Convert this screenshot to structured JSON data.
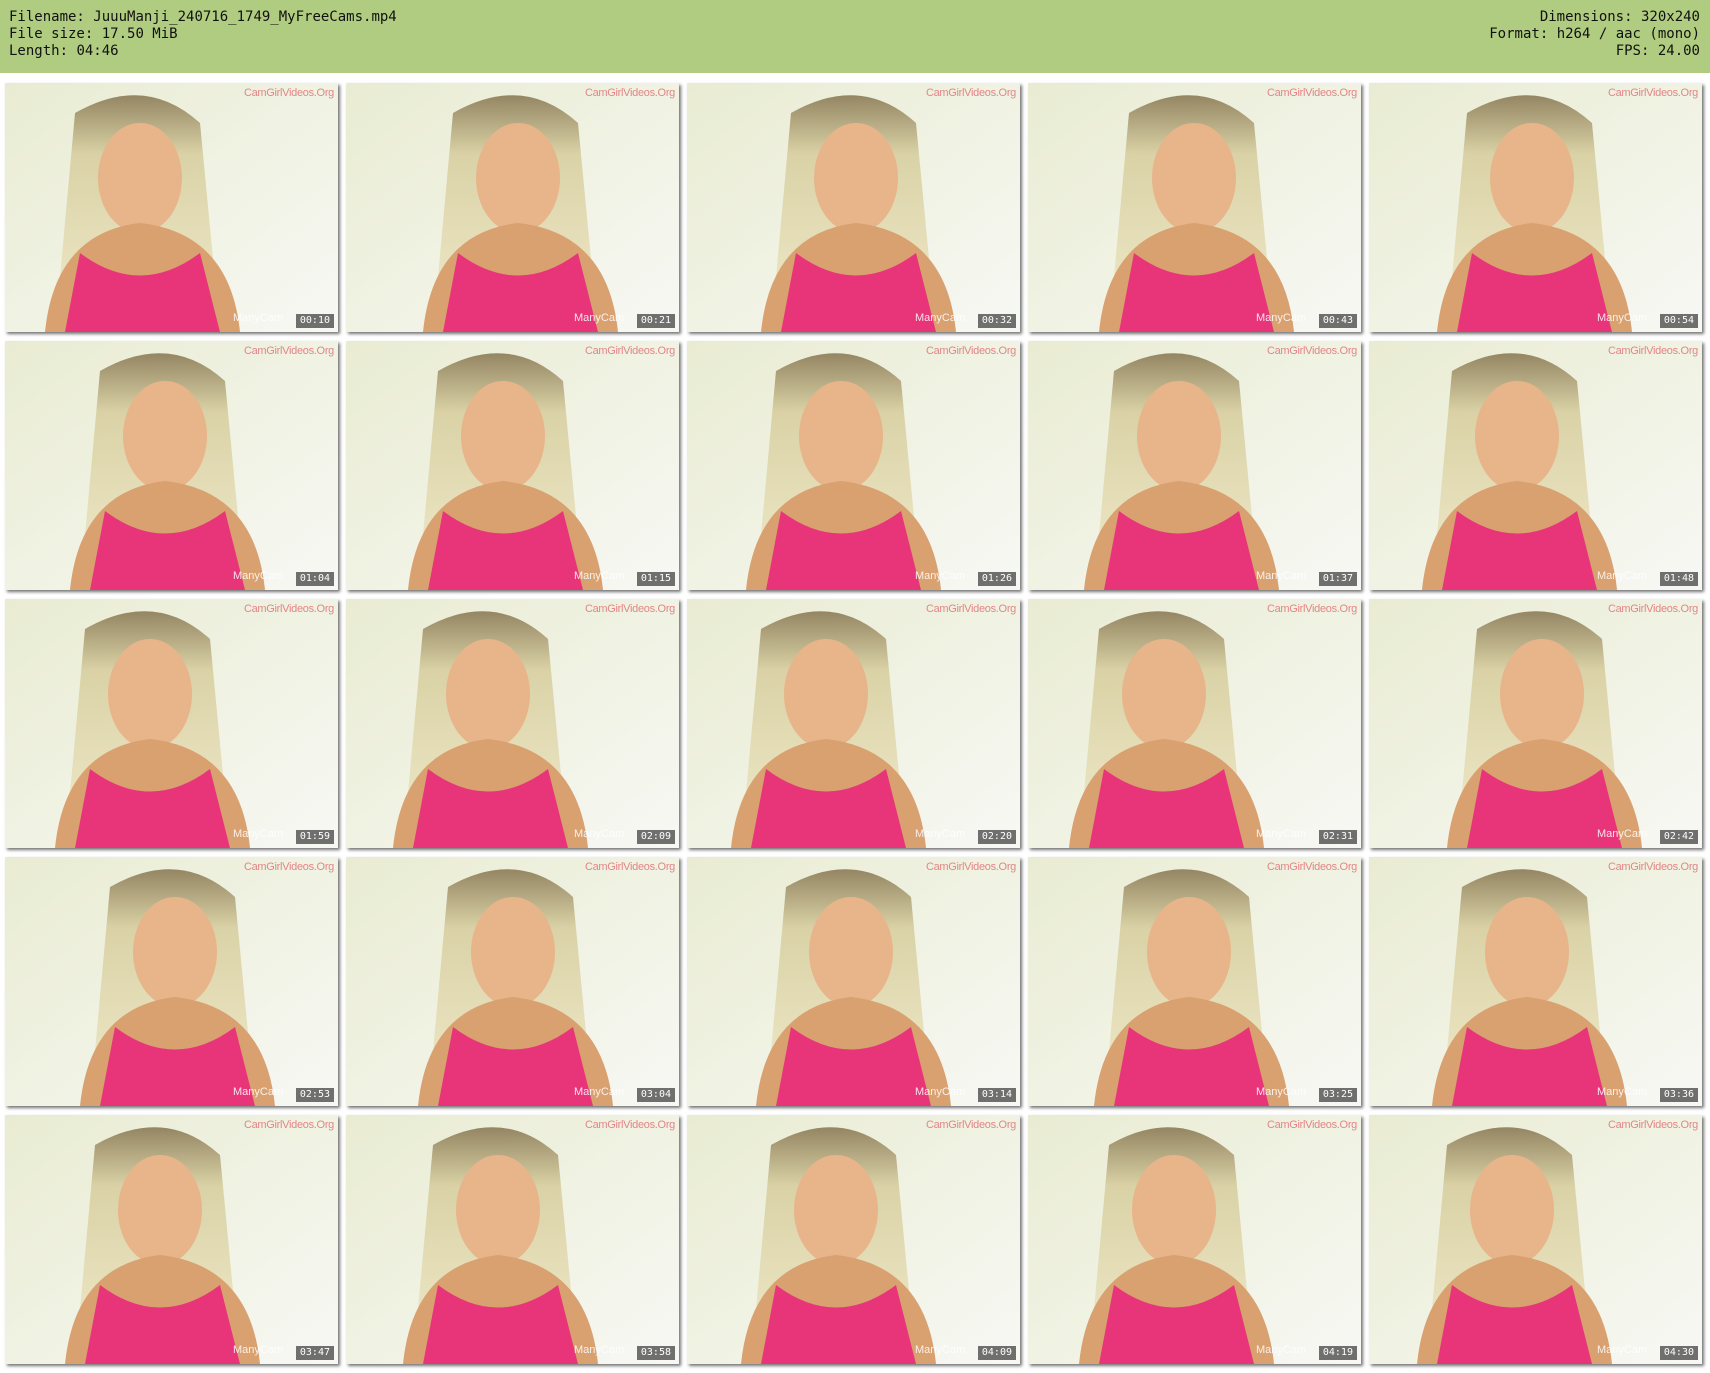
{
  "header": {
    "filename_label": "Filename:",
    "filename": "JuuuManji_240716_1749_MyFreeCams.mp4",
    "filesize_label": "File size:",
    "filesize": "17.50 MiB",
    "length_label": "Length:",
    "length": "04:46",
    "dimensions_label": "Dimensions:",
    "dimensions": "320x240",
    "format_label": "Format:",
    "format": "h264 / aac (mono)",
    "fps_label": "FPS:",
    "fps": "24.00"
  },
  "watermarks": {
    "top": "CamGirlVideos.Org",
    "bottom": "ManyCam"
  },
  "colors": {
    "header_bg": "#b0cc80",
    "top_bg": "#c8d098"
  },
  "thumbnails": [
    {
      "timestamp": "00:10"
    },
    {
      "timestamp": "00:21"
    },
    {
      "timestamp": "00:32"
    },
    {
      "timestamp": "00:43"
    },
    {
      "timestamp": "00:54"
    },
    {
      "timestamp": "01:04"
    },
    {
      "timestamp": "01:15"
    },
    {
      "timestamp": "01:26"
    },
    {
      "timestamp": "01:37"
    },
    {
      "timestamp": "01:48"
    },
    {
      "timestamp": "01:59"
    },
    {
      "timestamp": "02:09"
    },
    {
      "timestamp": "02:20"
    },
    {
      "timestamp": "02:31"
    },
    {
      "timestamp": "02:42"
    },
    {
      "timestamp": "02:53"
    },
    {
      "timestamp": "03:04"
    },
    {
      "timestamp": "03:14"
    },
    {
      "timestamp": "03:25"
    },
    {
      "timestamp": "03:36"
    },
    {
      "timestamp": "03:47"
    },
    {
      "timestamp": "03:58"
    },
    {
      "timestamp": "04:09"
    },
    {
      "timestamp": "04:19"
    },
    {
      "timestamp": "04:30"
    }
  ]
}
